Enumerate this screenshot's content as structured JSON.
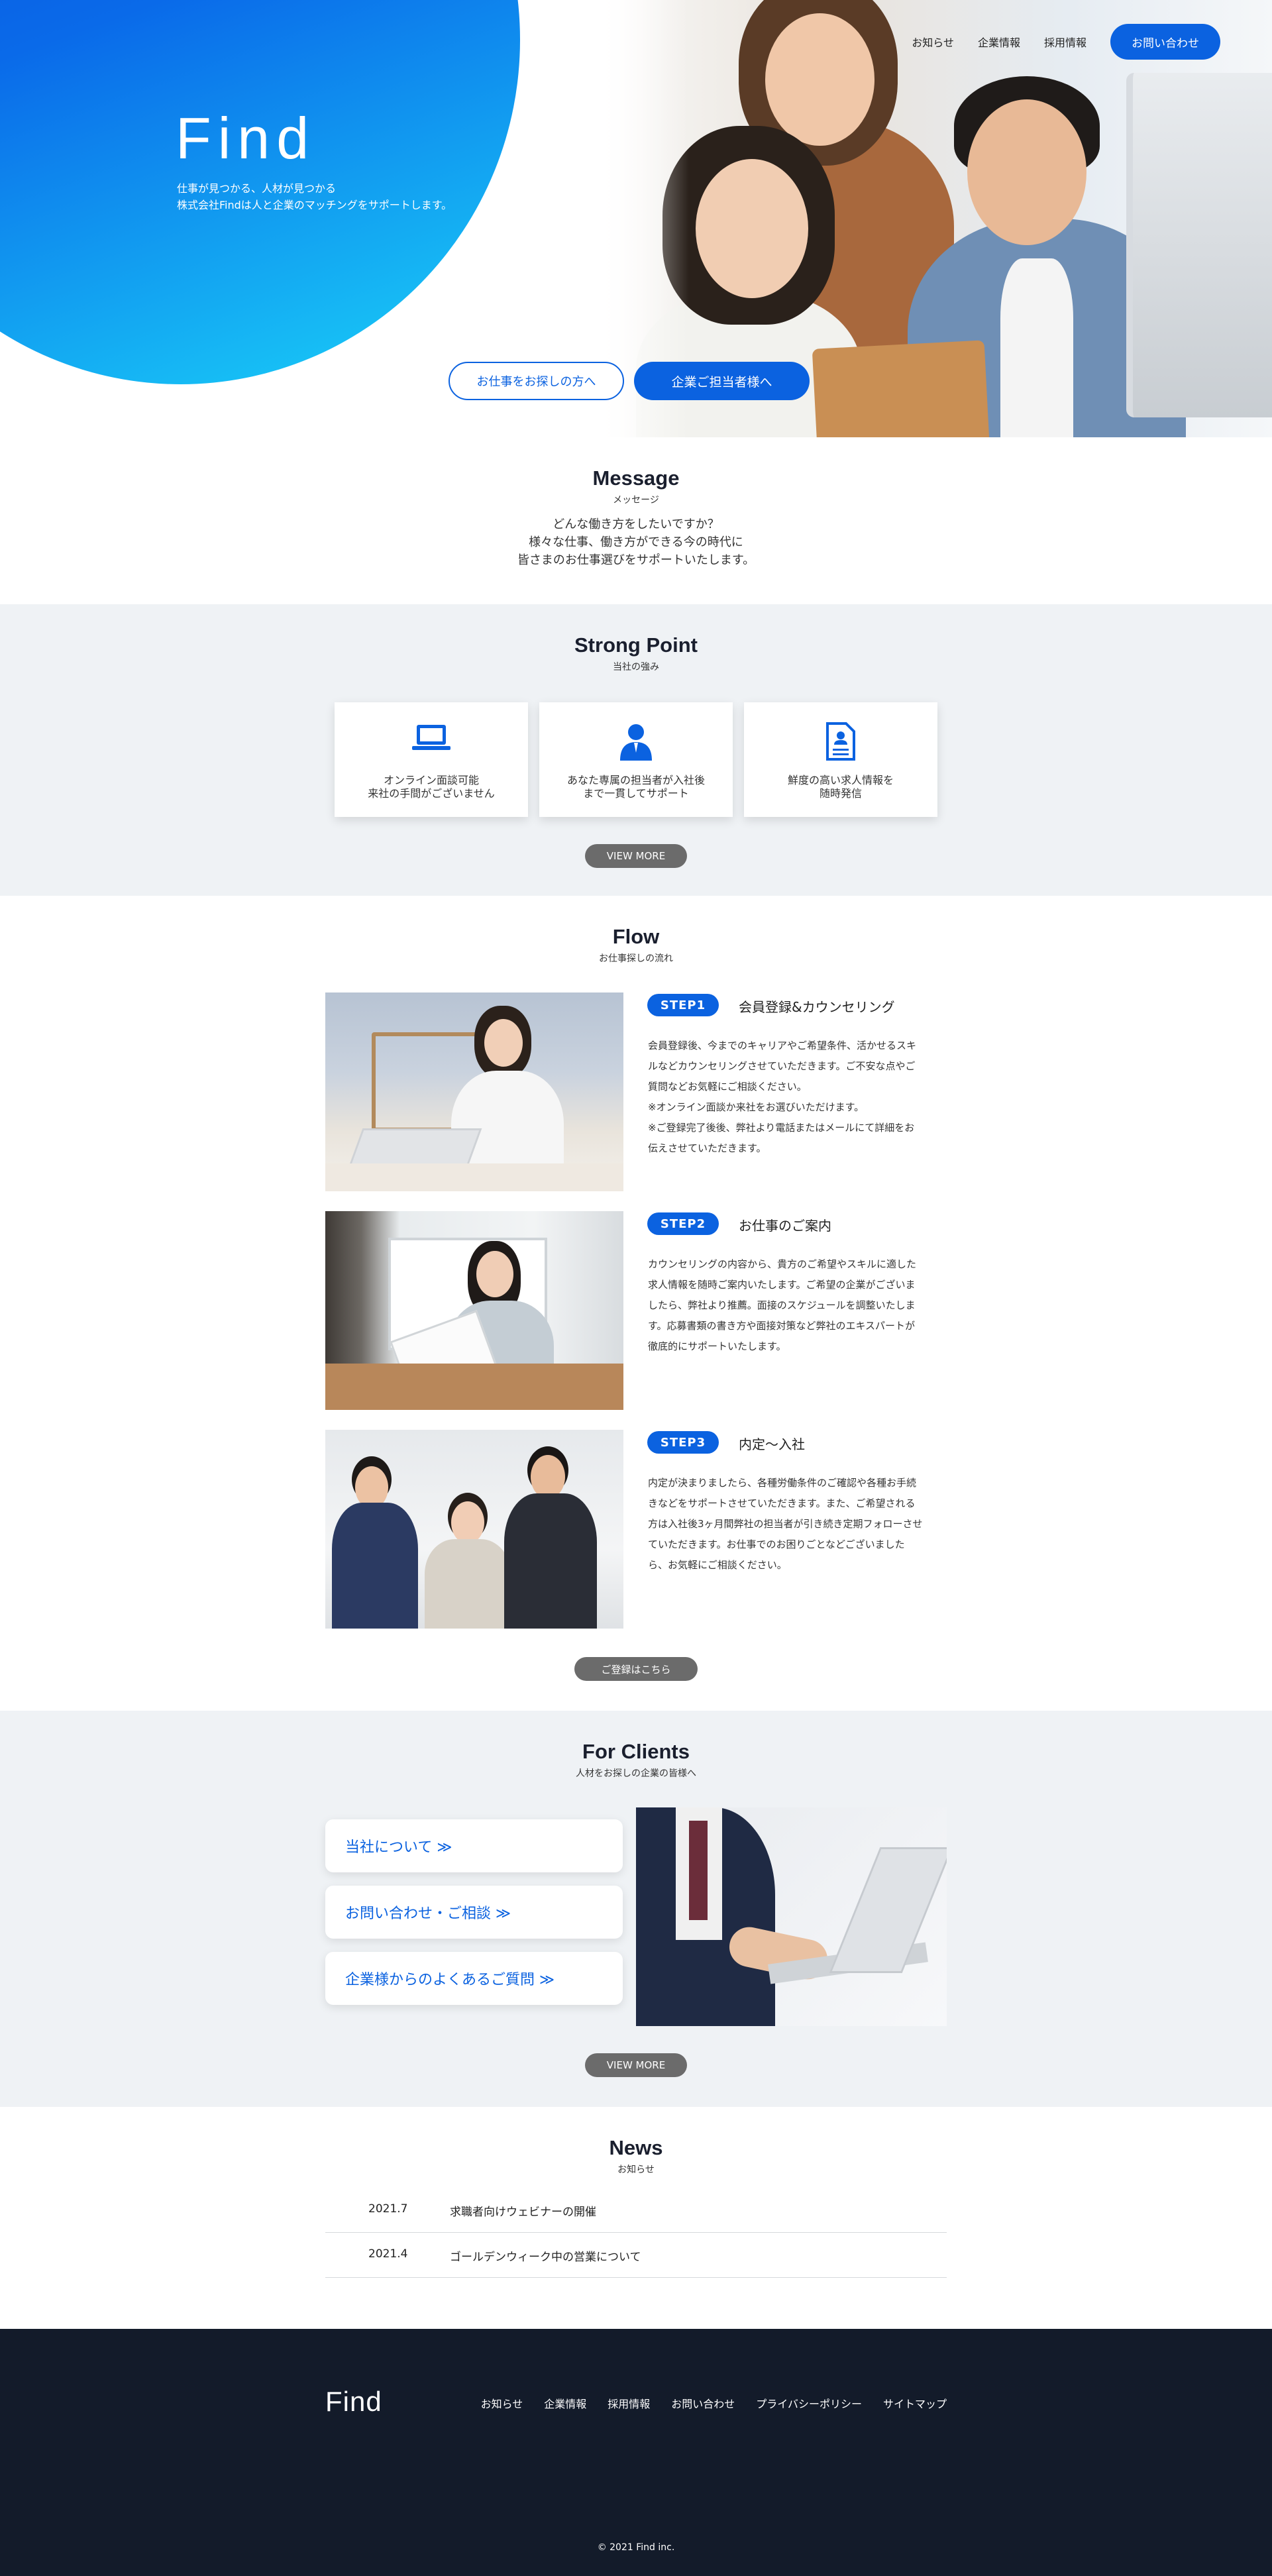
{
  "brand": {
    "logo": "Find",
    "primary_color": "#0b62e0",
    "footer_bg": "#131b2a",
    "section_bg": "#eff2f5"
  },
  "hero": {
    "logo": "Find",
    "tagline_line1": "仕事が見つかる、人材が見つかる",
    "tagline_line2": "株式会社Findは人と企業のマッチングをサポートします。",
    "btn_jobseeker": "お仕事をお探しの方へ",
    "btn_company": "企業ご担当者様へ"
  },
  "nav": {
    "items": [
      "お知らせ",
      "企業情報",
      "採用情報"
    ],
    "cta": "お問い合わせ"
  },
  "message": {
    "title": "Message",
    "subtitle": "メッセージ",
    "lines": [
      "どんな働き方をしたいですか？",
      "様々な仕事、働き方ができる今の時代に",
      "皆さまのお仕事選びをサポートいたします。"
    ]
  },
  "strong_point": {
    "title": "Strong Point",
    "subtitle": "当社の強み",
    "cards": [
      {
        "icon": "laptop-icon",
        "line1": "オンライン面談可能",
        "line2": "来社の手間がございません"
      },
      {
        "icon": "person-icon",
        "line1": "あなた専属の担当者が入社後",
        "line2": "まで一貫してサポート"
      },
      {
        "icon": "document-icon",
        "line1": "鮮度の高い求人情報を",
        "line2": "随時発信"
      }
    ],
    "button": "VIEW MORE"
  },
  "flow": {
    "title": "Flow",
    "subtitle": "お仕事探しの流れ",
    "steps": [
      {
        "badge": "STEP1",
        "title": "会員登録&カウンセリング",
        "lines": [
          "会員登録後、今までのキャリアやご希望条件、活かせるスキ",
          "ルなどカウンセリングさせていただきます。ご不安な点やご",
          "質問などお気軽にご相談ください。",
          "※オンライン面談か来社をお選びいただけます。",
          "※ご登録完了後後、弊社より電話またはメールにて詳細をお",
          "伝えさせていただきます。"
        ]
      },
      {
        "badge": "STEP2",
        "title": "お仕事のご案内",
        "lines": [
          "カウンセリングの内容から、貴方のご希望やスキルに適した",
          "求人情報を随時ご案内いたします。ご希望の企業がございま",
          "したら、弊社より推薦。面接のスケジュールを調整いたしま",
          "す。応募書類の書き方や面接対策など弊社のエキスパートが",
          "徹底的にサポートいたします。"
        ]
      },
      {
        "badge": "STEP3",
        "title": "内定〜入社",
        "lines": [
          "内定が決まりましたら、各種労働条件のご確認や各種お手続",
          "きなどをサポートさせていただきます。また、ご希望される",
          "方は入社後3ヶ月間弊社の担当者が引き続き定期フォローさせ",
          "ていただきます。お仕事でのお困りごとなどございました",
          "ら、お気軽にご相談ください。"
        ]
      }
    ],
    "button": "ご登録はこちら"
  },
  "clients": {
    "title": "For Clients",
    "subtitle": "人材をお探しの企業の皆様へ",
    "links": [
      "当社について ≫",
      "お問い合わせ・ご相談 ≫",
      "企業様からのよくあるご質問 ≫"
    ],
    "button": "VIEW MORE"
  },
  "news": {
    "title": "News",
    "subtitle": "お知らせ",
    "items": [
      {
        "date": "2021.7",
        "title": "求職者向けウェビナーの開催"
      },
      {
        "date": "2021.4",
        "title": "ゴールデンウィーク中の営業について"
      }
    ]
  },
  "footer": {
    "logo": "Find",
    "links": [
      "お知らせ",
      "企業情報",
      "採用情報",
      "お問い合わせ",
      "プライバシーポリシー",
      "サイトマップ"
    ],
    "copyright": "© 2021 Find inc."
  }
}
